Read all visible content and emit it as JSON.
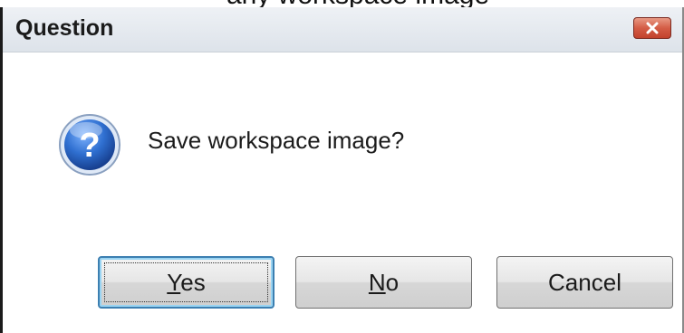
{
  "window": {
    "title": "Question",
    "cropped_text_above": "any workspace image"
  },
  "dialog": {
    "icon": "question-icon",
    "message": "Save workspace image?"
  },
  "buttons": {
    "yes": {
      "mnemonic": "Y",
      "rest": "es"
    },
    "no": {
      "mnemonic": "N",
      "rest": "o"
    },
    "cancel": {
      "label": "Cancel"
    }
  },
  "colors": {
    "close_button": "#d45d46",
    "icon_blue": "#1f5fb8",
    "default_button_border": "#3c7fb1"
  }
}
